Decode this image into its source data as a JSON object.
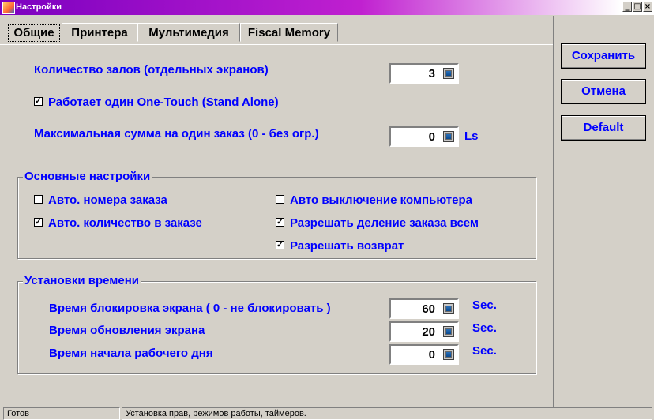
{
  "window": {
    "title": "Настройки",
    "buttons": [
      "_",
      "□",
      "×"
    ]
  },
  "tabs": [
    {
      "label": "Общие",
      "active": true
    },
    {
      "label": "Принтера",
      "active": false
    },
    {
      "label": "Мультимедия",
      "active": false
    },
    {
      "label": "Fiscal Memory",
      "active": false
    }
  ],
  "general": {
    "halls_label": "Количество залов (отдельных экранов)",
    "halls_value": "3",
    "standalone_label": "Работает один One-Touch (Stand Alone)",
    "standalone_checked": true,
    "max_sum_label": "Максимальная сумма на один заказ (0 - без огр.)",
    "max_sum_value": "0",
    "max_sum_unit": "Ls"
  },
  "basic": {
    "legend": "Основные настройки",
    "auto_order_number": {
      "label": "Авто. номера заказа",
      "checked": false
    },
    "auto_quantity": {
      "label": "Авто. количество в заказе",
      "checked": true
    },
    "auto_shutdown": {
      "label": "Авто выключение компьютера",
      "checked": false
    },
    "allow_split": {
      "label": "Разрешать деление заказа всем",
      "checked": true
    },
    "allow_return": {
      "label": "Разрешать возврат",
      "checked": true
    }
  },
  "time": {
    "legend": "Установки времени",
    "lock": {
      "label": "Время блокировка экрана ( 0 - не блокировать )",
      "value": "60",
      "unit": "Sec."
    },
    "refresh": {
      "label": "Время обновления экрана",
      "value": "20",
      "unit": "Sec."
    },
    "day_start": {
      "label": "Время начала рабочего дня",
      "value": "0",
      "unit": "Sec."
    }
  },
  "actions": {
    "save": "Сохранить",
    "cancel": "Отмена",
    "default": "Default"
  },
  "status": {
    "state": "Готов",
    "hint": "Установка прав, режимов работы, таймеров."
  }
}
